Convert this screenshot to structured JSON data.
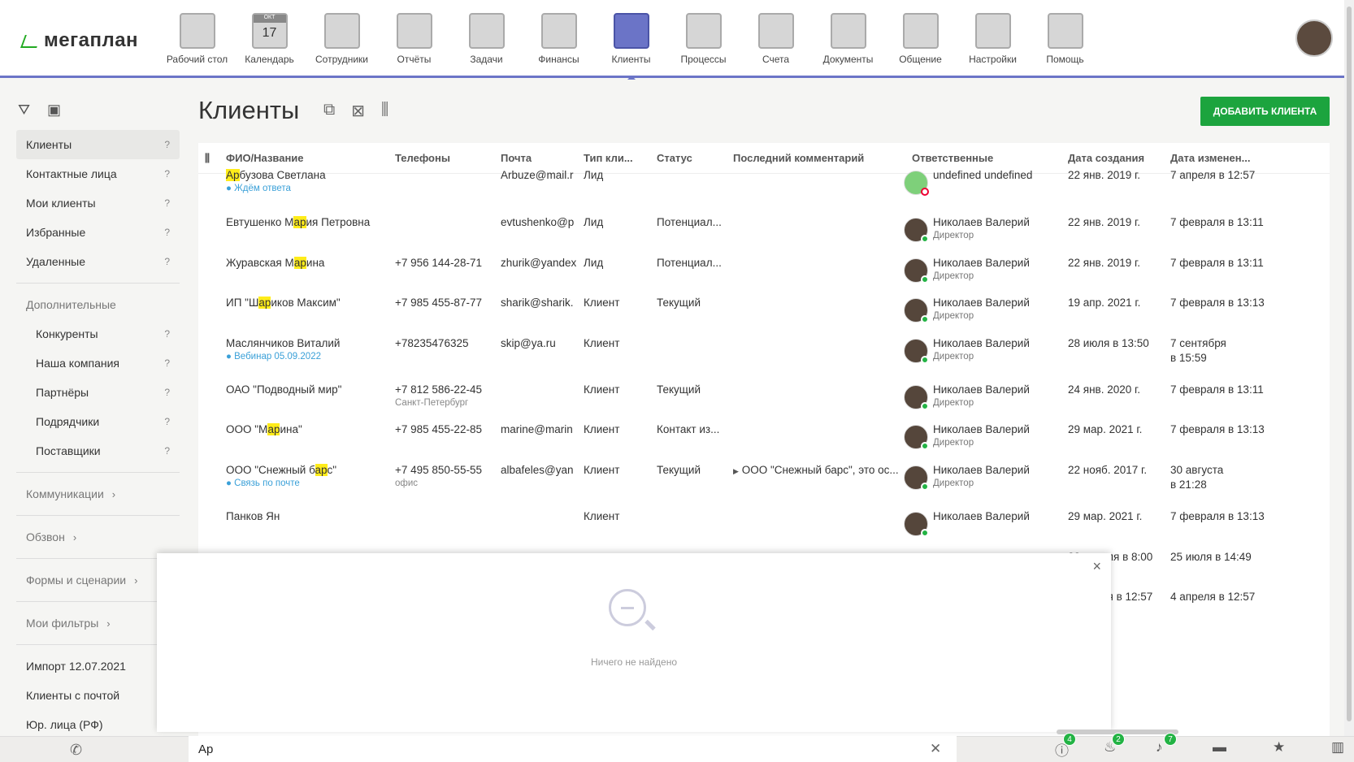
{
  "brand": {
    "logo": "мегаплан"
  },
  "nav": [
    {
      "label": "Рабочий стол",
      "icon": "dashboard-icon"
    },
    {
      "label": "Календарь",
      "icon": "calendar-icon",
      "day": "17",
      "month": "ОКТ"
    },
    {
      "label": "Сотрудники",
      "icon": "employees-icon"
    },
    {
      "label": "Отчёты",
      "icon": "reports-icon"
    },
    {
      "label": "Задачи",
      "icon": "tasks-icon"
    },
    {
      "label": "Финансы",
      "icon": "finance-safe-icon"
    },
    {
      "label": "Клиенты",
      "icon": "clients-book-icon",
      "active": true
    },
    {
      "label": "Процессы",
      "icon": "processes-icon"
    },
    {
      "label": "Счета",
      "icon": "invoices-icon"
    },
    {
      "label": "Документы",
      "icon": "documents-folder-icon"
    },
    {
      "label": "Общение",
      "icon": "chat-icon"
    },
    {
      "label": "Настройки",
      "icon": "settings-gear-icon"
    },
    {
      "label": "Помощь",
      "icon": "help-lifebuoy-icon"
    }
  ],
  "sidebar": {
    "items": [
      {
        "label": "Клиенты",
        "q": "?",
        "active": true
      },
      {
        "label": "Контактные лица",
        "q": "?"
      },
      {
        "label": "Мои клиенты",
        "q": "?"
      },
      {
        "label": "Избранные",
        "q": "?"
      },
      {
        "label": "Удаленные",
        "q": "?"
      }
    ],
    "extra_title": "Дополнительные",
    "extra": [
      {
        "label": "Конкуренты",
        "q": "?"
      },
      {
        "label": "Наша компания",
        "q": "?"
      },
      {
        "label": "Партнёры",
        "q": "?"
      },
      {
        "label": "Подрядчики",
        "q": "?"
      },
      {
        "label": "Поставщики",
        "q": "?"
      }
    ],
    "groups": [
      "Коммуникации",
      "Обзвон",
      "Формы и сценарии",
      "Мои фильтры"
    ],
    "bottom": [
      "Импорт 12.07.2021",
      "Клиенты с почтой",
      "Юр. лица (РФ)"
    ]
  },
  "page": {
    "title": "Клиенты",
    "add_button": "ДОБАВИТЬ КЛИЕНТА"
  },
  "table": {
    "columns": [
      "ФИО/Название",
      "Телефоны",
      "Почта",
      "Тип кли...",
      "Статус",
      "Последний комментарий",
      "Ответственные",
      "Дата создания",
      "Дата изменен..."
    ],
    "rows": [
      {
        "name_pre": "",
        "name_hl": "Ар",
        "name_post": "бузова Светлана",
        "name_sub": "● Ждём ответа",
        "phone": "",
        "phone_sub": "",
        "email": "Arbuze@mail.r",
        "type": "Лид",
        "status": "",
        "comment": "",
        "resp": "undefined undefined",
        "resp_sub": "",
        "created": "22 янв. 2019 г.",
        "updated": "7 апреля в 12:57",
        "updated2": ""
      },
      {
        "name_pre": "Евтушенко М",
        "name_hl": "ар",
        "name_post": "ия Петровна",
        "name_sub": "",
        "phone": "",
        "phone_sub": "",
        "email": "evtushenko@p",
        "type": "Лид",
        "status": "Потенциал...",
        "comment": "",
        "resp": "Николаев Валерий",
        "resp_sub": "Директор",
        "created": "22 янв. 2019 г.",
        "updated": "7 февраля в 13:11",
        "updated2": ""
      },
      {
        "name_pre": "Журавская М",
        "name_hl": "ар",
        "name_post": "ина",
        "name_sub": "",
        "phone": "+7 956 144-28-71",
        "phone_sub": "",
        "email": "zhurik@yandex",
        "type": "Лид",
        "status": "Потенциал...",
        "comment": "",
        "resp": "Николаев Валерий",
        "resp_sub": "Директор",
        "created": "22 янв. 2019 г.",
        "updated": "7 февраля в 13:11",
        "updated2": ""
      },
      {
        "name_pre": "ИП \"Ш",
        "name_hl": "ар",
        "name_post": "иков Максим\"",
        "name_sub": "",
        "phone": "+7 985 455-87-77",
        "phone_sub": "",
        "email": "sharik@sharik.",
        "type": "Клиент",
        "status": "Текущий",
        "comment": "",
        "resp": "Николаев Валерий",
        "resp_sub": "Директор",
        "created": "19 апр. 2021 г.",
        "updated": "7 февраля в 13:13",
        "updated2": ""
      },
      {
        "name_pre": "Маслянчиков Виталий",
        "name_hl": "",
        "name_post": "",
        "name_sub": "● Вебинар 05.09.2022",
        "phone": "+78235476325",
        "phone_sub": "",
        "email": "skip@ya.ru",
        "type": "Клиент",
        "status": "",
        "comment": "",
        "resp": "Николаев Валерий",
        "resp_sub": "Директор",
        "created": "28 июля в 13:50",
        "updated": "7 сентября",
        "updated2": "в 15:59"
      },
      {
        "name_pre": "ОАО \"Подводный мир\"",
        "name_hl": "",
        "name_post": "",
        "name_sub": "",
        "phone": "+7 812 586-22-45",
        "phone_sub": "Санкт-Петербург",
        "email": "",
        "type": "Клиент",
        "status": "Текущий",
        "comment": "",
        "resp": "Николаев Валерий",
        "resp_sub": "Директор",
        "created": "24 янв. 2020 г.",
        "updated": "7 февраля в 13:11",
        "updated2": ""
      },
      {
        "name_pre": "ООО \"М",
        "name_hl": "ар",
        "name_post": "ина\"",
        "name_sub": "",
        "phone": "+7 985 455-22-85",
        "phone_sub": "",
        "email": "marine@marin",
        "type": "Клиент",
        "status": "Контакт из...",
        "comment": "",
        "resp": "Николаев Валерий",
        "resp_sub": "Директор",
        "created": "29 мар. 2021 г.",
        "updated": "7 февраля в 13:13",
        "updated2": ""
      },
      {
        "name_pre": "ООО \"Снежный б",
        "name_hl": "ар",
        "name_post": "с\"",
        "name_sub": "● Связь по почте",
        "phone": "+7 495 850-55-55",
        "phone_sub": "офис",
        "email": "albafeles@yan",
        "type": "Клиент",
        "status": "Текущий",
        "comment": "ООО \"Снежный барс\", это ос...",
        "resp": "Николаев Валерий",
        "resp_sub": "Директор",
        "created": "22 нояб. 2017 г.",
        "updated": "30 августа",
        "updated2": "в 21:28"
      },
      {
        "name_pre": "Панков Ян",
        "name_hl": "",
        "name_post": "",
        "name_sub": "",
        "phone": "",
        "phone_sub": "",
        "email": "",
        "type": "Клиент",
        "status": "",
        "comment": "",
        "resp": "Николаев Валерий",
        "resp_sub": "",
        "created": "29 мар. 2021 г.",
        "updated": "7 февраля в 13:13",
        "updated2": ""
      },
      {
        "name_pre": "",
        "name_hl": "",
        "name_post": "",
        "name_sub": "",
        "phone": "",
        "phone_sub": "",
        "email": "",
        "type": "",
        "status": "",
        "comment": "",
        "resp": "",
        "resp_sub": "",
        "created": "22 апреля в 8:00",
        "updated": "25 июля в 14:49",
        "updated2": ""
      },
      {
        "name_pre": "",
        "name_hl": "",
        "name_post": "",
        "name_sub": "",
        "phone": "",
        "phone_sub": "",
        "email": "",
        "type": "",
        "status": "",
        "comment": "",
        "resp": "",
        "resp_sub": "",
        "created": "4 апреля в 12:57",
        "updated": "4 апреля в 12:57",
        "updated2": ""
      }
    ]
  },
  "popup": {
    "empty_text": "Ничего не найдено",
    "close": "×"
  },
  "search": {
    "value": "Ар"
  },
  "bottom_badges": {
    "alerts": "4",
    "fire": "2",
    "bell": "7"
  },
  "colors": {
    "accent": "#6b74c7",
    "add_button": "#1ca43e",
    "highlight": "#ffec1a",
    "online": "#23b344"
  }
}
